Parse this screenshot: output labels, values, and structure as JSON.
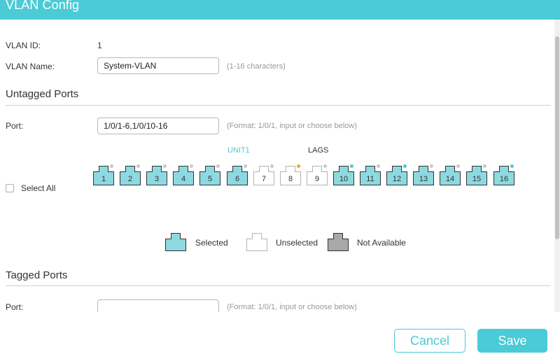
{
  "window": {
    "title": "VLAN Config"
  },
  "vlan": {
    "id_label": "VLAN ID:",
    "id_value": "1",
    "name_label": "VLAN Name:",
    "name_value": "System-VLAN",
    "name_hint": "(1-16 characters)"
  },
  "untagged": {
    "title": "Untagged Ports",
    "port_label": "Port:",
    "port_value": "1/0/1-6,1/0/10-16",
    "port_hint": "(Format: 1/0/1, input or choose below)",
    "unit_tab": "UNIT1",
    "lags_tab": "LAGS",
    "select_all": "Select All",
    "ports": [
      {
        "num": "1",
        "state": "selected",
        "led": "gray"
      },
      {
        "num": "2",
        "state": "selected",
        "led": "gray"
      },
      {
        "num": "3",
        "state": "selected",
        "led": "gray"
      },
      {
        "num": "4",
        "state": "selected",
        "led": "gray"
      },
      {
        "num": "5",
        "state": "selected",
        "led": "gray"
      },
      {
        "num": "6",
        "state": "selected",
        "led": "gray"
      },
      {
        "num": "7",
        "state": "unselected",
        "led": "gray"
      },
      {
        "num": "8",
        "state": "unselected",
        "led": "orange"
      },
      {
        "num": "9",
        "state": "unselected",
        "led": "gray"
      },
      {
        "num": "10",
        "state": "selected",
        "led": "cyan"
      },
      {
        "num": "11",
        "state": "selected",
        "led": "gray"
      },
      {
        "num": "12",
        "state": "selected",
        "led": "cyan"
      },
      {
        "num": "13",
        "state": "selected",
        "led": "gray"
      },
      {
        "num": "14",
        "state": "selected",
        "led": "gray"
      },
      {
        "num": "15",
        "state": "selected",
        "led": "gray"
      },
      {
        "num": "16",
        "state": "selected",
        "led": "cyan"
      }
    ]
  },
  "legend": {
    "selected": "Selected",
    "unselected": "Unselected",
    "not_available": "Not Available"
  },
  "tagged": {
    "title": "Tagged Ports",
    "port_label": "Port:",
    "port_value": "",
    "port_hint": "(Format: 1/0/1, input or choose below)"
  },
  "buttons": {
    "cancel": "Cancel",
    "save": "Save"
  },
  "colors": {
    "accent": "#4acbd6",
    "selected_fill": "#8dd9e1",
    "unavailable_fill": "#a8a8a8",
    "led_gray": "#c8c8c8",
    "led_orange": "#f5a623",
    "led_cyan": "#4acbd6"
  }
}
